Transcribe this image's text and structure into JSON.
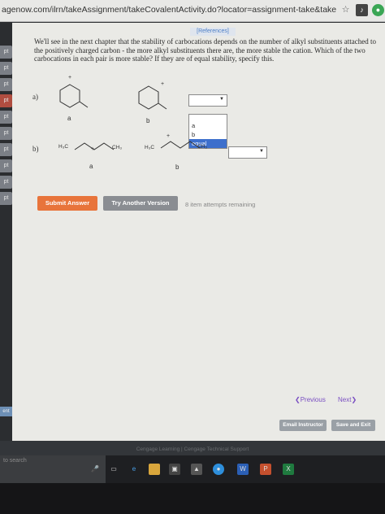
{
  "browser": {
    "url": "agenow.com/ilrn/takeAssignment/takeCovalentActivity.do?locator=assignment-take&takeAssignmen..."
  },
  "sidebar": {
    "points": [
      "pt",
      "pt",
      "pt",
      "pt",
      "pt",
      "pt",
      "pt",
      "pt",
      "pt",
      "pt",
      "pt"
    ],
    "bottom_tab": "ent"
  },
  "main": {
    "references_label": "[References]",
    "question": "We'll see in the next chapter that the stability of carbocations depends on the number of alkyl substituents attached to the positively charged carbon - the more alkyl substituents there are, the more stable the cation. Which of the two carbocations in each pair is more stable? If they are of equal stability, specify this.",
    "part_a": {
      "label": "a)",
      "mol_a_caption": "a",
      "mol_b_caption": "b",
      "charge": "+",
      "dropdown_options": [
        "a",
        "b",
        "equal"
      ],
      "dropdown_selected": "equal"
    },
    "part_b": {
      "label": "b)",
      "mol_a_caption": "a",
      "mol_b_caption": "b",
      "h3c": "H₃C",
      "ch3": "CH₃",
      "charge": "+"
    },
    "submit_label": "Submit Answer",
    "try_another_label": "Try Another Version",
    "attempts_text": "8 item attempts remaining",
    "previous_label": "Previous",
    "next_label": "Next",
    "email_label": "Email Instructor",
    "save_label": "Save and Exit"
  },
  "footer": {
    "text": "Cengage Learning  |  Cengage Technical Support"
  },
  "taskbar": {
    "search_placeholder": "to search"
  },
  "colors": {
    "submit": "#e8743b",
    "try_another": "#8a8d92",
    "dropdown_highlight": "#3d6fcc",
    "red_tab": "#b04d40"
  }
}
